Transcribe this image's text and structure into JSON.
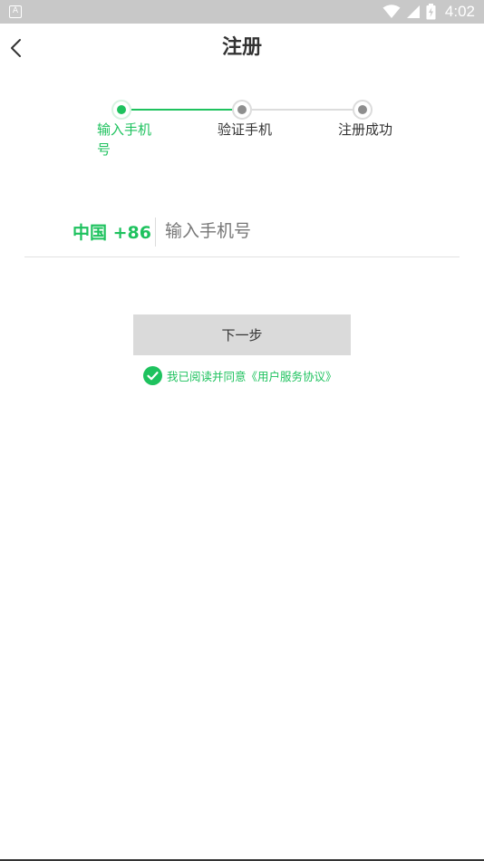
{
  "status_bar": {
    "app_icon_letter": "A",
    "time": "4:02",
    "icons": [
      "wifi-icon",
      "cell-signal-icon",
      "battery-charging-icon"
    ]
  },
  "header": {
    "title": "注册",
    "back_icon": "chevron-left-icon"
  },
  "stepper": {
    "steps": [
      {
        "label": "输入手机号",
        "active": true
      },
      {
        "label": "验证手机",
        "active": false
      },
      {
        "label": "注册成功",
        "active": false
      }
    ],
    "active_color": "#1ec25e",
    "inactive_color": "#8e8e8e"
  },
  "phone": {
    "country_code": "中国 +86",
    "placeholder": "输入手机号",
    "value": ""
  },
  "next_button": {
    "label": "下一步"
  },
  "agreement": {
    "text": "我已阅读并同意《用户服务协议》",
    "checked": true
  },
  "colors": {
    "accent": "#1ec25e",
    "status_bar": "#c8c8c8",
    "button_bg": "#dadada"
  }
}
